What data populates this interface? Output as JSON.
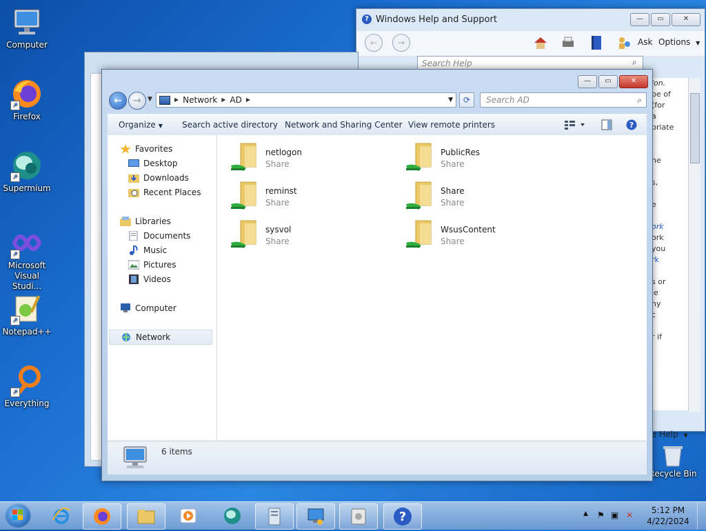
{
  "desktop": {
    "icons": [
      {
        "label": "Computer"
      },
      {
        "label": "Firefox"
      },
      {
        "label": "Supermium"
      },
      {
        "label": "Microsoft Visual Studi..."
      },
      {
        "label": "Notepad++"
      },
      {
        "label": "Everything"
      },
      {
        "label": "Recycle Bin"
      }
    ]
  },
  "help_window": {
    "title": "Windows Help and Support",
    "toolbar": {
      "ask": "Ask",
      "options": "Options"
    },
    "search_placeholder": "Search Help",
    "footer": "e Help",
    "body_fragments": [
      "ion.",
      "pe of",
      "(for",
      "a",
      "priate",
      "",
      "",
      "he",
      "",
      "s,",
      "",
      "e",
      "",
      "ork",
      "ork",
      "you",
      "rk",
      "",
      "s or",
      "le",
      "ny",
      "c",
      "",
      "r if"
    ]
  },
  "explorer": {
    "breadcrumb": [
      "Network",
      "AD"
    ],
    "search_placeholder": "Search AD",
    "commands": {
      "organize": "Organize",
      "search_ad": "Search active directory",
      "network_center": "Network and Sharing Center",
      "remote_printers": "View remote printers"
    },
    "nav": {
      "favorites": "Favorites",
      "desktop": "Desktop",
      "downloads": "Downloads",
      "recent": "Recent Places",
      "libraries": "Libraries",
      "documents": "Documents",
      "music": "Music",
      "pictures": "Pictures",
      "videos": "Videos",
      "computer": "Computer",
      "network": "Network"
    },
    "items": [
      {
        "name": "netlogon",
        "type": "Share"
      },
      {
        "name": "PublicRes",
        "type": "Share"
      },
      {
        "name": "reminst",
        "type": "Share"
      },
      {
        "name": "Share",
        "type": "Share"
      },
      {
        "name": "sysvol",
        "type": "Share"
      },
      {
        "name": "WsusContent",
        "type": "Share"
      }
    ],
    "status": "6 items"
  },
  "taskbar": {
    "time": "5:12 PM",
    "date": "4/22/2024"
  },
  "colors": {
    "accent": "#2a5cc4",
    "folder": "#e9c865",
    "share_green": "#2fae3f"
  }
}
